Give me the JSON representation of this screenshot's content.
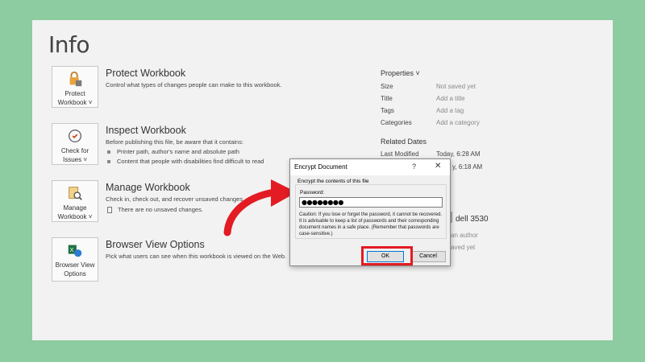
{
  "info_title": "Info",
  "sections": {
    "protect": {
      "button_label_1": "Protect",
      "button_label_2": "Workbook ˅",
      "title": "Protect Workbook",
      "description": "Control what types of changes people can make to this workbook."
    },
    "inspect": {
      "button_label_1": "Check for",
      "button_label_2": "Issues ˅",
      "title": "Inspect Workbook",
      "description": "Before publishing this file, be aware that it contains:",
      "bullets": [
        "Printer path, author's name and absolute path",
        "Content that people with disabilities find difficult to read"
      ]
    },
    "manage": {
      "button_label_1": "Manage",
      "button_label_2": "Workbook ˅",
      "title": "Manage Workbook",
      "description": "Check in, check out, and recover unsaved changes.",
      "note": "There are no unsaved changes."
    },
    "browser": {
      "button_label_1": "Browser View",
      "button_label_2": "Options",
      "title": "Browser View Options",
      "description": "Pick what users can see when this workbook is viewed on the Web."
    }
  },
  "properties": {
    "heading": "Properties ˅",
    "rows": [
      {
        "key": "Size",
        "value": "Not saved yet"
      },
      {
        "key": "Title",
        "value": "Add a title"
      },
      {
        "key": "Tags",
        "value": "Add a tag"
      },
      {
        "key": "Categories",
        "value": "Add a category"
      }
    ],
    "related_dates_heading": "Related Dates",
    "last_modified_key": "Last Modified",
    "last_modified_value": "Today, 6:28 AM",
    "created_partial": "y, 6:18 AM",
    "author_partial": "dell 3530",
    "add_author_partial": "an author",
    "saved_partial": "aved yet"
  },
  "dialog": {
    "title": "Encrypt Document",
    "help": "?",
    "close": "✕",
    "group_label": "Encrypt the contents of this file",
    "password_label": "Password:",
    "password_value": "●●●●●●●●",
    "caution": "Caution: If you lose or forget the password, it cannot be recovered. It is advisable to keep a list of passwords and their corresponding document names in a safe place. (Remember that passwords are case-sensitive.)",
    "ok_label": "OK",
    "cancel_label": "Cancel"
  },
  "colors": {
    "background": "#8dcba0",
    "panel": "#f2f2f2",
    "highlight": "#e31b23",
    "arrow": "#e31b23"
  }
}
